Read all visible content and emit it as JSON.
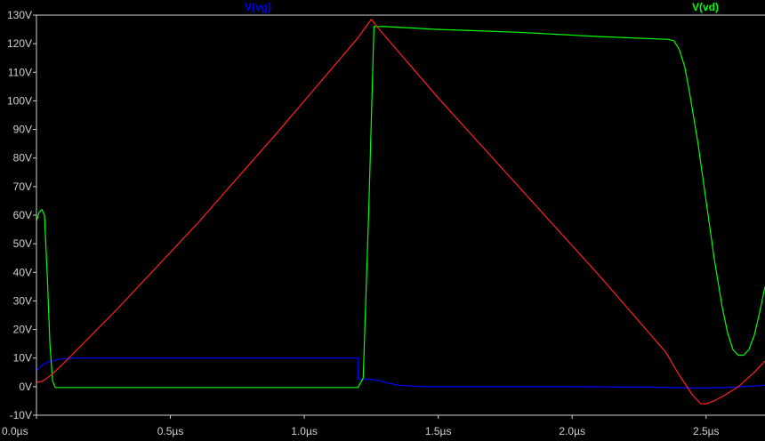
{
  "chart_data": {
    "type": "line",
    "x_unit": "µs",
    "xlim": [
      0.0,
      2.72
    ],
    "ylim": [
      -10,
      130
    ],
    "grid": false,
    "legend_placement": "top",
    "x_ticks": [
      0.0,
      0.5,
      1.0,
      1.5,
      2.0,
      2.5
    ],
    "x_tick_labels": [
      "0.0µs",
      "0.5µs",
      "1.0µs",
      "1.5µs",
      "2.0µs",
      "2.5µs"
    ],
    "y_ticks": [
      -10,
      0,
      10,
      20,
      30,
      40,
      50,
      60,
      70,
      80,
      90,
      100,
      110,
      120,
      130
    ],
    "y_tick_labels": [
      "-10V",
      "0V",
      "10V",
      "20V",
      "30V",
      "40V",
      "50V",
      "60V",
      "70V",
      "80V",
      "90V",
      "100V",
      "110V",
      "120V",
      "130V"
    ],
    "series": [
      {
        "name": "V(vg)",
        "color": "#0000ff",
        "show_legend": true,
        "legend_position": "center",
        "x": [
          0.0,
          0.01,
          0.02,
          0.04,
          0.06,
          0.08,
          0.1,
          0.15,
          0.3,
          0.6,
          0.9,
          1.1,
          1.2,
          1.2,
          1.21,
          1.22,
          1.25,
          1.28,
          1.3,
          1.35,
          1.45,
          1.7,
          2.0,
          2.3,
          2.5,
          2.6,
          2.72
        ],
        "y": [
          5.5,
          6.5,
          7.5,
          8.5,
          9.0,
          9.5,
          9.8,
          10.0,
          10.0,
          10.0,
          10.0,
          10.0,
          10.0,
          3.0,
          2.5,
          2.5,
          2.5,
          2.2,
          1.5,
          0.5,
          0.0,
          0.0,
          0.0,
          -0.2,
          -0.5,
          -0.2,
          0.5
        ]
      },
      {
        "name": "V(vd)",
        "color": "#00ff00",
        "show_legend": true,
        "legend_position": "right",
        "x": [
          0.0,
          0.01,
          0.02,
          0.03,
          0.04,
          0.05,
          0.06,
          0.07,
          0.1,
          0.3,
          0.6,
          0.9,
          1.1,
          1.2,
          1.22,
          1.24,
          1.26,
          1.3,
          1.5,
          1.8,
          2.1,
          2.36,
          2.38,
          2.4,
          2.42,
          2.44,
          2.47,
          2.5,
          2.53,
          2.56,
          2.58,
          2.6,
          2.62,
          2.64,
          2.66,
          2.68,
          2.7,
          2.72
        ],
        "y": [
          58,
          61,
          62,
          60,
          40,
          15,
          2,
          -0.3,
          -0.3,
          -0.3,
          -0.3,
          -0.3,
          -0.3,
          -0.3,
          3,
          60,
          126,
          126,
          125,
          124,
          122.5,
          121.5,
          121,
          118,
          112,
          102,
          85,
          65,
          45,
          28,
          19,
          13,
          11,
          11,
          13,
          18,
          26,
          35
        ]
      },
      {
        "name": "",
        "color": "#ff2020",
        "show_legend": false,
        "legend_position": "",
        "x": [
          0.0,
          0.02,
          0.04,
          0.06,
          0.1,
          0.3,
          0.6,
          0.9,
          1.2,
          1.23,
          1.25,
          1.28,
          1.5,
          1.8,
          2.1,
          2.35,
          2.4,
          2.45,
          2.48,
          2.5,
          2.53,
          2.57,
          2.62,
          2.68,
          2.72
        ],
        "y": [
          1.5,
          1.8,
          3,
          4.5,
          8,
          27,
          57,
          89,
          122,
          126,
          128.5,
          125,
          101,
          70,
          39,
          12,
          4,
          -3,
          -6,
          -6,
          -5,
          -3,
          0,
          5,
          9
        ]
      }
    ]
  }
}
